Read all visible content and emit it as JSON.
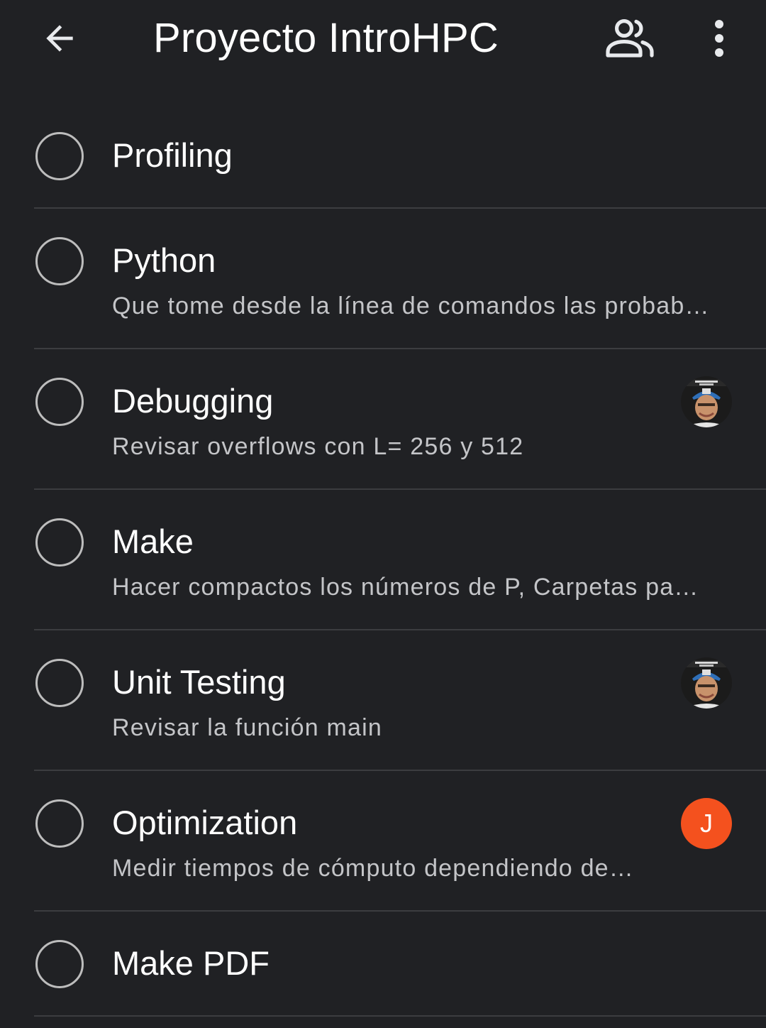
{
  "header": {
    "title": "Proyecto IntroHPC",
    "back_icon": "arrow-back-icon",
    "members_icon": "people-icon",
    "menu_icon": "more-vert-icon"
  },
  "colors": {
    "background": "#202124",
    "divider": "#3c3d40",
    "checkbox_outline": "#bdbdbd",
    "secondary_text": "#c4c5c8",
    "avatar_orange": "#f4511e"
  },
  "tasks": [
    {
      "title": "Profiling",
      "description": "",
      "assignee": ""
    },
    {
      "title": "Python",
      "description": "Que tome desde la línea de comandos las probab…",
      "assignee": ""
    },
    {
      "title": "Debugging",
      "description": "Revisar overflows con L= 256 y 512",
      "assignee": "photo"
    },
    {
      "title": "Make",
      "description": "Hacer compactos los números de P, Carpetas pa…",
      "assignee": ""
    },
    {
      "title": "Unit Testing",
      "description": "Revisar la función main",
      "assignee": "photo"
    },
    {
      "title": "Optimization",
      "description": "Medir tiempos de cómputo dependiendo de…",
      "assignee": "J"
    },
    {
      "title": "Make PDF",
      "description": "",
      "assignee": ""
    }
  ]
}
